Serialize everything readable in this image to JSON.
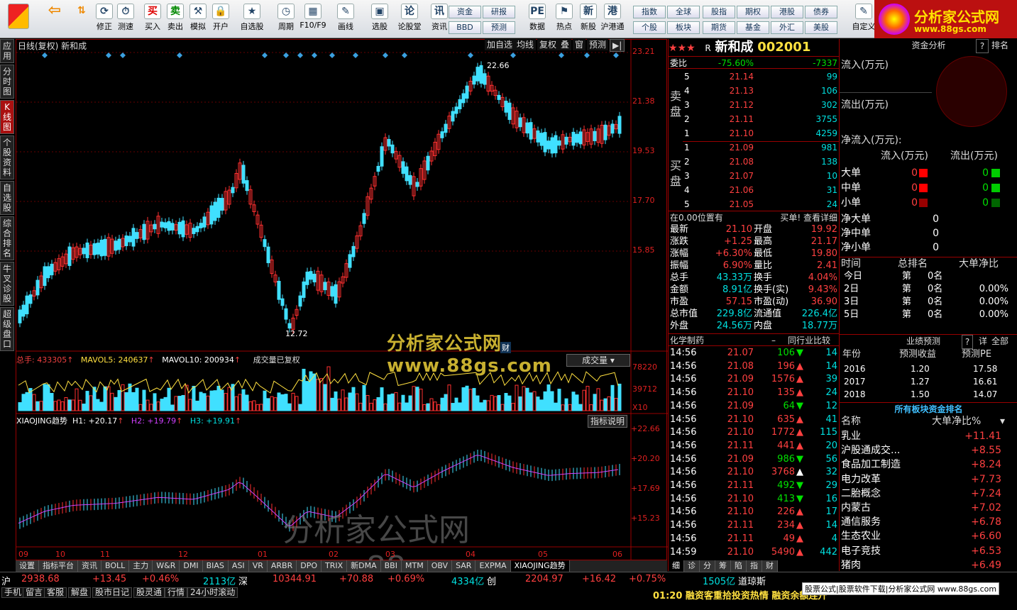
{
  "toolbar": {
    "items": [
      "修正",
      "测速",
      "买入",
      "卖出",
      "模拟",
      "开户",
      "自选股",
      "周期",
      "F10/F9",
      "画线",
      "选股",
      "论股堂",
      "资讯",
      "数据",
      "热点",
      "新股",
      "沪港通",
      "自定义"
    ],
    "small": [
      "资金",
      "BBD",
      "研报",
      "预测",
      "指数",
      "个股",
      "全球",
      "板块",
      "股指",
      "期货",
      "期权",
      "基金",
      "港股",
      "外汇",
      "债券",
      "美股"
    ]
  },
  "logo": {
    "line1": "分析家公式网",
    "line2": "www.88gs.com"
  },
  "sidebar": [
    "应用",
    "分时图",
    "K线图",
    "个股资料",
    "自选股",
    "综合排名",
    "牛叉诊股",
    "超级盘口"
  ],
  "chart": {
    "title": "日线(复权) 新和成",
    "buttons": [
      "加自选",
      "均线",
      "复权",
      "叠",
      "窗",
      "预测"
    ],
    "price_axis": [
      "23.21",
      "21.38",
      "19.53",
      "17.70",
      "15.85"
    ],
    "hi_label": "22.66",
    "lo_label": "12.72",
    "cai": "财",
    "vol_header": {
      "a": "总手: 433305",
      "b": "MAVOL5: 240637",
      "c": "MAVOL10: 200934",
      "d": "成交量已复权",
      "btn": "成交量"
    },
    "vol_axis": [
      "78220",
      "39712",
      "X10"
    ],
    "ind_header": {
      "a": "XIAOJING趋势",
      "h1": "H1: +20.17",
      "h2": "H2: +19.79",
      "h3": "H3: +19.91",
      "btn": "指标说明"
    },
    "ind_axis": [
      "+22.66",
      "+20.20",
      "+17.69",
      "+15.23"
    ],
    "months": [
      "09",
      "10",
      "11",
      "12",
      "01",
      "02",
      "03",
      "04",
      "05",
      "06"
    ],
    "watermark1": "分析家公式网 www.88gs.com",
    "watermark2": "分析家公式网www.88gs.com"
  },
  "tabs": [
    "设置",
    "指标平台",
    "资讯",
    "BOLL",
    "主力",
    "W&R",
    "DMI",
    "BIAS",
    "ASI",
    "VR",
    "ARBR",
    "DPO",
    "TRIX",
    "新DMA",
    "BBI",
    "MTM",
    "OBV",
    "SAR",
    "EXPMA",
    "XIAOJING趋势"
  ],
  "quote": {
    "stars": "★★★",
    "r": "R",
    "name": "新和成",
    "code": "002001",
    "wb": {
      "label": "委比",
      "pct": "-75.60%",
      "diff": "-7337"
    },
    "sell_label": "卖盘",
    "buy_label": "买盘",
    "sells": [
      {
        "n": "5",
        "p": "21.14",
        "v": "99"
      },
      {
        "n": "4",
        "p": "21.13",
        "v": "106"
      },
      {
        "n": "3",
        "p": "21.12",
        "v": "302"
      },
      {
        "n": "2",
        "p": "21.11",
        "v": "3755"
      },
      {
        "n": "1",
        "p": "21.10",
        "v": "4259"
      }
    ],
    "buys": [
      {
        "n": "1",
        "p": "21.09",
        "v": "981"
      },
      {
        "n": "2",
        "p": "21.08",
        "v": "138"
      },
      {
        "n": "3",
        "p": "21.07",
        "v": "10"
      },
      {
        "n": "4",
        "p": "21.06",
        "v": "31"
      },
      {
        "n": "5",
        "p": "21.05",
        "v": "24"
      }
    ],
    "pos_text": "在0.00位置有",
    "detail": "买单! 查看详细",
    "stats": [
      [
        "最新",
        "21.10",
        "开盘",
        "19.92"
      ],
      [
        "涨跌",
        "+1.25",
        "最高",
        "21.17"
      ],
      [
        "涨幅",
        "+6.30%",
        "最低",
        "19.80"
      ],
      [
        "振幅",
        "6.90%",
        "量比",
        "2.41"
      ],
      [
        "总手",
        "43.33万",
        "换手",
        "4.04%"
      ],
      [
        "金额",
        "8.91亿",
        "换手(实)",
        "9.43%"
      ],
      [
        "市盈",
        "57.15",
        "市盈(动)",
        "36.90"
      ],
      [
        "总市值",
        "229.8亿",
        "流通值",
        "226.4亿"
      ],
      [
        "外盘",
        "24.56万",
        "内盘",
        "18.77万"
      ]
    ],
    "industry": "化学制药",
    "compare": "同行业比较",
    "ticks": [
      [
        "14:56",
        "21.07",
        "106",
        "14"
      ],
      [
        "14:56",
        "21.08",
        "196",
        "14"
      ],
      [
        "14:56",
        "21.09",
        "1576",
        "39"
      ],
      [
        "14:56",
        "21.10",
        "135",
        "24"
      ],
      [
        "14:56",
        "21.09",
        "64",
        "12"
      ],
      [
        "14:56",
        "21.10",
        "635",
        "41"
      ],
      [
        "14:56",
        "21.10",
        "1772",
        "115"
      ],
      [
        "14:56",
        "21.11",
        "441",
        "20"
      ],
      [
        "14:56",
        "21.09",
        "986",
        "56"
      ],
      [
        "14:56",
        "21.10",
        "3768",
        "32"
      ],
      [
        "14:56",
        "21.11",
        "492",
        "29"
      ],
      [
        "14:56",
        "21.10",
        "413",
        "16"
      ],
      [
        "14:56",
        "21.10",
        "226",
        "17"
      ],
      [
        "14:56",
        "21.11",
        "234",
        "14"
      ],
      [
        "14:56",
        "21.11",
        "49",
        "4"
      ],
      [
        "14:59",
        "21.10",
        "5490",
        "442"
      ]
    ],
    "bottom_tabs": [
      "细",
      "诊",
      "分",
      "筹",
      "陷",
      "指",
      "财"
    ]
  },
  "fund": {
    "title": "资金分析",
    "q": "?",
    "rank": "排名",
    "in": "流入(万元)",
    "out": "流出(万元)",
    "net": "净流入(万元):",
    "cols": [
      "流入(万元)",
      "流出(万元)"
    ],
    "rows": [
      [
        "大单",
        "0",
        "0"
      ],
      [
        "中单",
        "0",
        "0"
      ],
      [
        "小单",
        "0",
        "0"
      ]
    ],
    "nets": [
      [
        "净大单",
        "0"
      ],
      [
        "净中单",
        "0"
      ],
      [
        "净小单",
        "0"
      ]
    ],
    "time_hdr": [
      "时间",
      "总排名",
      "大单净比"
    ],
    "times": [
      [
        "今日",
        "第",
        "0名",
        ""
      ],
      [
        "2日",
        "第",
        "0名",
        "0.00%"
      ],
      [
        "3日",
        "第",
        "0名",
        "0.00%"
      ],
      [
        "5日",
        "第",
        "0名",
        "0.00%"
      ]
    ],
    "yj": {
      "title": "业绩预测",
      "q": "?",
      "d": "详",
      "all": "全部",
      "hdr": [
        "年份",
        "预测收益",
        "预测PE"
      ],
      "rows": [
        [
          "2016",
          "1.20",
          "17.58"
        ],
        [
          "2017",
          "1.27",
          "16.61"
        ],
        [
          "2018",
          "1.50",
          "14.07"
        ]
      ]
    },
    "sector": {
      "title": "所有板块资金排名",
      "hdr": [
        "名称",
        "大单净比%"
      ],
      "rows": [
        [
          "乳业",
          "+11.41"
        ],
        [
          "沪股通成交...",
          "+8.55"
        ],
        [
          "食品加工制造",
          "+8.24"
        ],
        [
          "电力改革",
          "+7.73"
        ],
        [
          "二胎概念",
          "+7.24"
        ],
        [
          "内蒙古",
          "+7.02"
        ],
        [
          "通信服务",
          "+6.78"
        ],
        [
          "生态农业",
          "+6.60"
        ],
        [
          "电子竞技",
          "+6.53"
        ],
        [
          "猪肉",
          "+6.49"
        ]
      ]
    }
  },
  "status": {
    "sh": "沪",
    "sh_v": "2938.68",
    "sh_c": "+13.45",
    "sh_p": "+0.46%",
    "sh_a": "2113亿",
    "sz": "深",
    "sz_v": "10344.91",
    "sz_c": "+70.88",
    "sz_p": "+0.69%",
    "sz_a": "4334亿",
    "cy": "创",
    "cy_v": "2204.97",
    "cy_c": "+16.42",
    "cy_p": "+0.75%",
    "cy_a": "1505亿",
    "dj": "道琼斯",
    "links": [
      "手机",
      "留言",
      "客服",
      "解盘",
      "股市日记",
      "股灵通",
      "行情",
      "24小时滚动"
    ],
    "news": "01:20 融资客重拾投资热情 融资余额连升",
    "ad": "股票公式|股票软件下载|分析家公式网 www.88gs.com"
  }
}
